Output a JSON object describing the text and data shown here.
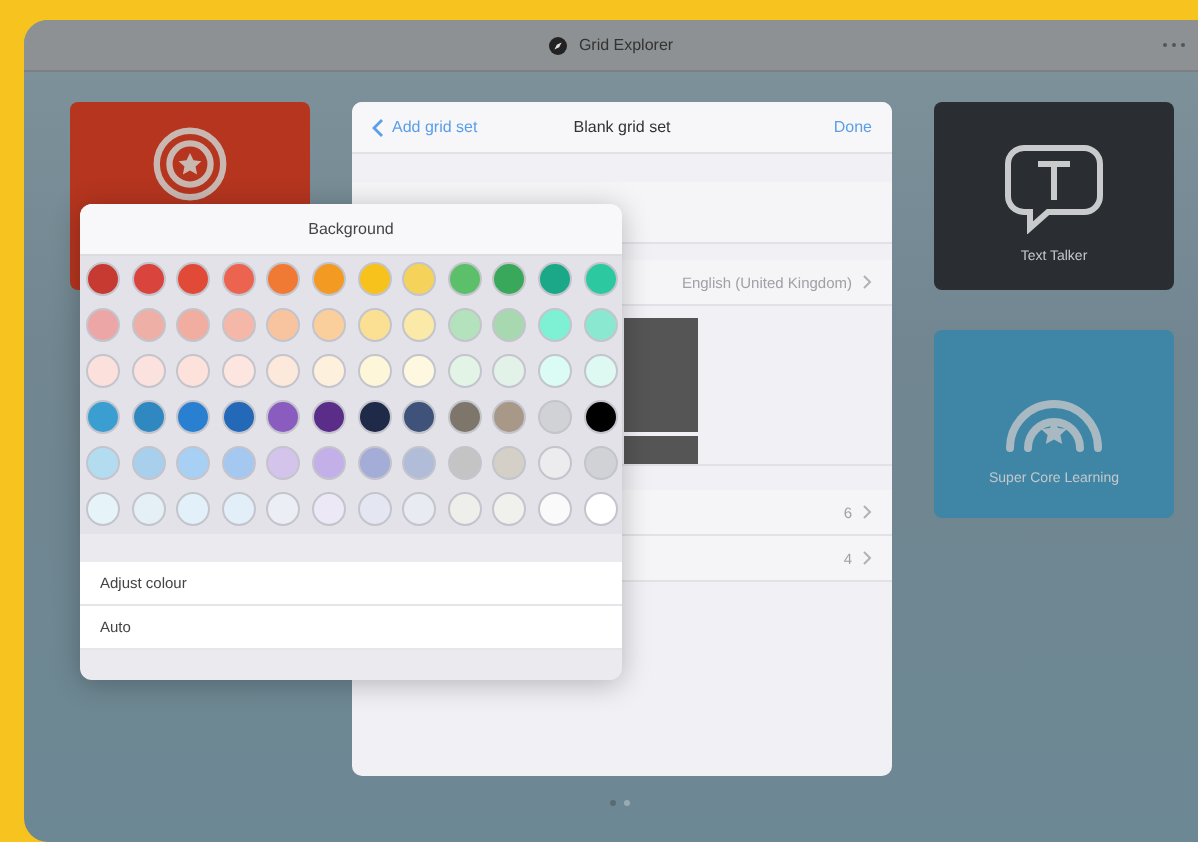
{
  "title_bar": {
    "title": "Grid Explorer"
  },
  "tiles": [
    {
      "kind": "target",
      "color": "#b5351f"
    },
    {
      "kind": "bubble",
      "label": "Text Talker",
      "color": "#2a2e33"
    },
    {
      "kind": "rainbow",
      "label": "Super Core Learning",
      "color": "#3f86a6"
    }
  ],
  "sheet": {
    "back": "Add grid set",
    "title": "Blank grid set",
    "done": "Done",
    "rows": [
      {
        "kind": "blank"
      },
      {
        "kind": "value",
        "value": "English (United Kingdom)"
      },
      {
        "kind": "preview"
      },
      {
        "kind": "value",
        "value": "6"
      },
      {
        "kind": "value",
        "value": "4"
      }
    ]
  },
  "popover": {
    "title": "Background",
    "swatches": [
      [
        {
          "color": "#c63a32"
        },
        {
          "color": "#d9443c"
        },
        {
          "color": "#e04a36"
        },
        {
          "color": "#ec6450"
        },
        {
          "color": "#f07a34"
        },
        {
          "color": "#f39a22"
        },
        {
          "color": "#f7c21c"
        },
        {
          "color": "#f5d35a"
        },
        {
          "color": "#5cbf6a"
        },
        {
          "color": "#3aa85a"
        },
        {
          "color": "#1aa888"
        },
        {
          "color": "#2cc8a0"
        }
      ],
      [
        {
          "color": "#eda6a6"
        },
        {
          "color": "#eeb0a6"
        },
        {
          "color": "#f0ada0"
        },
        {
          "color": "#f5b8a8"
        },
        {
          "color": "#f8c4a0"
        },
        {
          "color": "#fbcf9c"
        },
        {
          "color": "#fbdf92"
        },
        {
          "color": "#fbe9a8"
        },
        {
          "color": "#b4e2bc"
        },
        {
          "color": "#a8d8b0"
        },
        {
          "color": "#7ef0d4"
        },
        {
          "color": "#8ae8d0"
        }
      ],
      [
        {
          "color": "#fbe0dc"
        },
        {
          "color": "#fbe2de"
        },
        {
          "color": "#fde2dc"
        },
        {
          "color": "#fde6e0"
        },
        {
          "color": "#fde8dc"
        },
        {
          "color": "#fdf0dc"
        },
        {
          "color": "#fdf6d8"
        },
        {
          "color": "#fef8e0"
        },
        {
          "color": "#e2f4e6"
        },
        {
          "color": "#e2f2e8"
        },
        {
          "color": "#dafcf4"
        },
        {
          "color": "#def8f2"
        }
      ],
      [
        {
          "color": "#3a9ed0"
        },
        {
          "color": "#3088c0"
        },
        {
          "color": "#2a80d0"
        },
        {
          "color": "#2468b8"
        },
        {
          "color": "#8a5cc0"
        },
        {
          "color": "#5a2e88"
        },
        {
          "color": "#1e2a48"
        },
        {
          "color": "#3e527a"
        },
        {
          "color": "#7e766a"
        },
        {
          "color": "#a89888"
        },
        {
          "color": "#d0d2d6"
        },
        {
          "color": "#000000"
        }
      ],
      [
        {
          "color": "#b4dcf0"
        },
        {
          "color": "#a8d0ec"
        },
        {
          "color": "#a8d0f4"
        },
        {
          "color": "#a4c8f0"
        },
        {
          "color": "#d4c4ec"
        },
        {
          "color": "#c4b0e8"
        },
        {
          "color": "#a4acd8"
        },
        {
          "color": "#b0bcd8"
        },
        {
          "color": "#c4c4c4"
        },
        {
          "color": "#d4d0c8"
        },
        {
          "color": "#ececee"
        },
        {
          "color": "#d0d2d6"
        }
      ],
      [
        {
          "color": "#e6f4fa"
        },
        {
          "color": "#e4f0f6"
        },
        {
          "color": "#e2f0fa"
        },
        {
          "color": "#e2eef8"
        },
        {
          "color": "#eceef6"
        },
        {
          "color": "#ece8f6"
        },
        {
          "color": "#e4e6f2"
        },
        {
          "color": "#e8ebf2"
        },
        {
          "color": "#eeeeea"
        },
        {
          "color": "#f0f0ec"
        },
        {
          "color": "#fafafa"
        },
        {
          "color": "#ffffff"
        }
      ]
    ],
    "options": [
      "Adjust colour",
      "Auto"
    ]
  },
  "pages": [
    {
      "selected": true
    },
    {
      "selected": false
    }
  ]
}
